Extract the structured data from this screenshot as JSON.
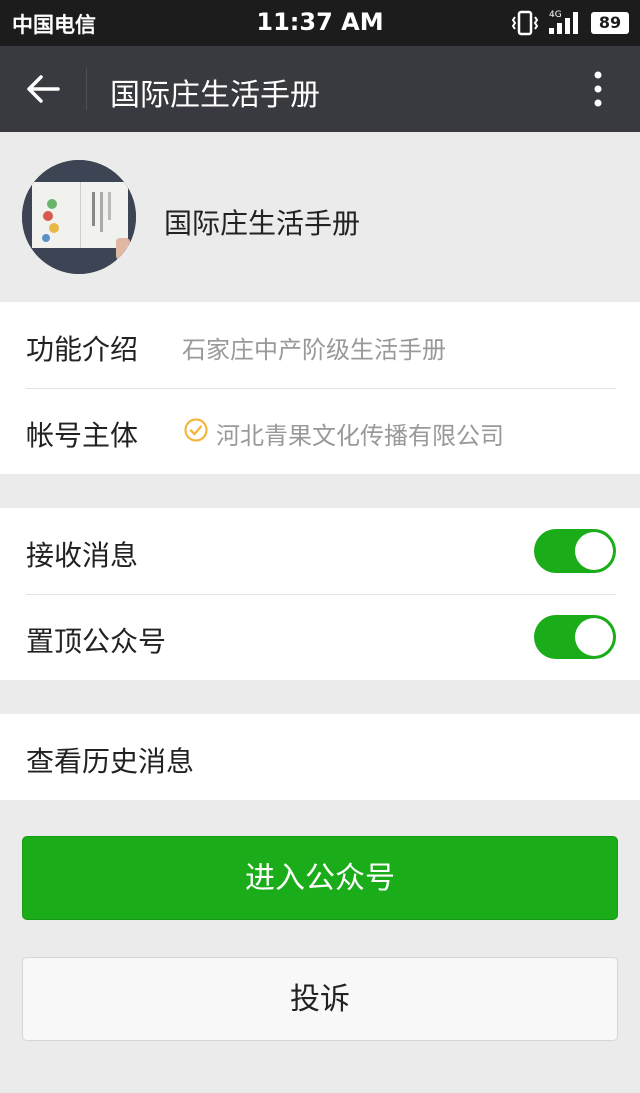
{
  "status_bar": {
    "carrier": "中国电信",
    "time": "11:37 AM",
    "network": "4G",
    "battery": "89"
  },
  "app_bar": {
    "title": "国际庄生活手册"
  },
  "profile": {
    "name": "国际庄生活手册"
  },
  "info": {
    "function_label": "功能介绍",
    "function_value": "石家庄中产阶级生活手册",
    "account_label": "帐号主体",
    "account_value": "河北青果文化传播有限公司"
  },
  "settings": {
    "receive_label": "接收消息",
    "receive_on": true,
    "pin_label": "置顶公众号",
    "pin_on": true
  },
  "history": {
    "label": "查看历史消息"
  },
  "actions": {
    "enter_label": "进入公众号",
    "report_label": "投诉"
  },
  "colors": {
    "accent": "#1aad19",
    "appbar": "#393a3f",
    "background": "#ebebeb"
  }
}
